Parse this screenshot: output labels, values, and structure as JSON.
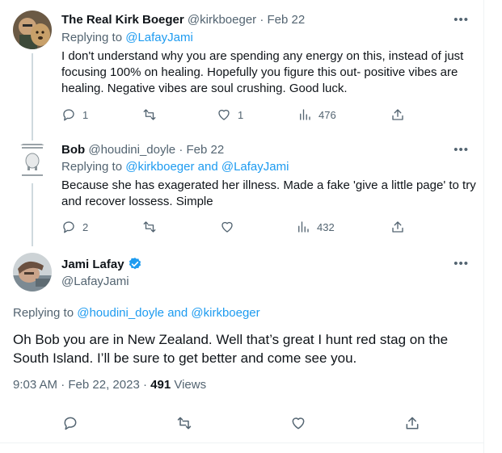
{
  "tweets": [
    {
      "name": "The Real Kirk Boeger",
      "handle": "@kirkboeger",
      "date": "Feb 22",
      "replying_label": "Replying to",
      "replying_to": "@LafayJami",
      "text": "I don't understand why you are spending any energy on this, instead of just focusing 100% on healing.  Hopefully you figure this out- positive vibes are healing.  Negative vibes are soul crushing.  Good luck.",
      "replies": "1",
      "retweets": "",
      "likes": "1",
      "views": "476"
    },
    {
      "name": "Bob",
      "handle": "@houdini_doyle",
      "date": "Feb 22",
      "replying_label": "Replying to",
      "replying_to": "@kirkboeger and @LafayJami",
      "text": "Because she has exagerated her illness. Made a fake 'give a little  page' to try and recover lossess. Simple",
      "replies": "2",
      "retweets": "",
      "likes": "",
      "views": "432"
    }
  ],
  "main_tweet": {
    "name": "Jami Lafay",
    "handle": "@LafayJami",
    "replying_label": "Replying to",
    "replying_to": "@houdini_doyle and @kirkboeger",
    "text": "Oh Bob you are in New Zealand. Well that’s great I hunt red stag on the South Island. I’ll be sure to get better and come see you.",
    "time": "9:03 AM",
    "date": "Feb 22, 2023",
    "views_count": "491",
    "views_label": "Views"
  },
  "ui": {
    "separator": "·",
    "more": "•••"
  },
  "colors": {
    "accent": "#1d9bf0",
    "muted": "#536471",
    "text": "#0f1419",
    "verified": "#1d9bf0"
  },
  "icons": [
    "reply-icon",
    "retweet-icon",
    "like-icon",
    "views-icon",
    "share-icon",
    "verified-badge-icon",
    "more-icon"
  ]
}
